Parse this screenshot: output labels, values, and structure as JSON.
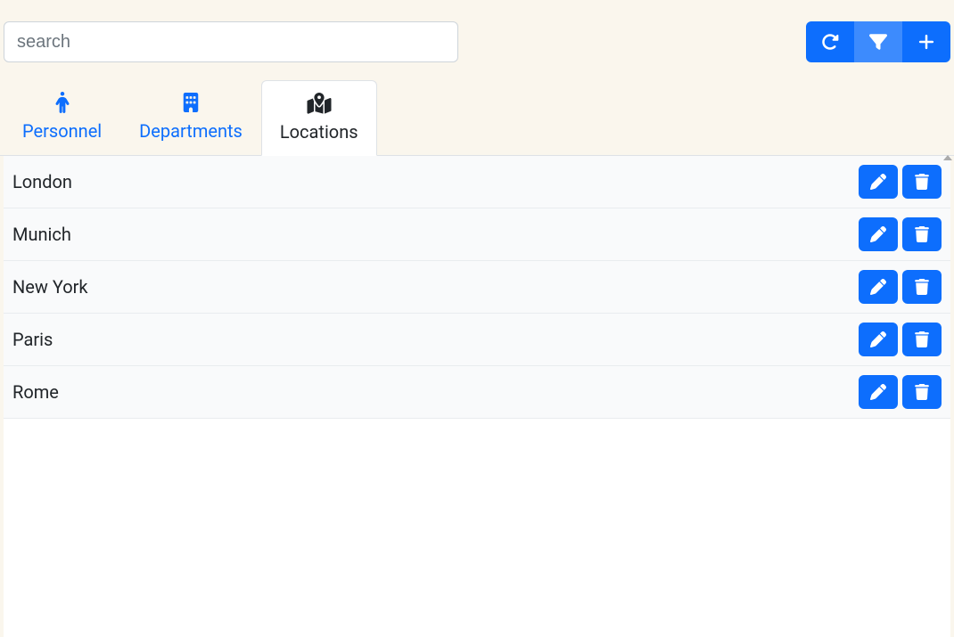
{
  "search": {
    "placeholder": "search",
    "value": ""
  },
  "toolbar": {
    "refresh": "refresh",
    "filter": "filter",
    "add": "add"
  },
  "tabs": [
    {
      "id": "personnel",
      "label": "Personnel",
      "icon": "person",
      "active": false
    },
    {
      "id": "departments",
      "label": "Departments",
      "icon": "building",
      "active": false
    },
    {
      "id": "locations",
      "label": "Locations",
      "icon": "map",
      "active": true
    }
  ],
  "locations": [
    {
      "name": "London"
    },
    {
      "name": "Munich"
    },
    {
      "name": "New York"
    },
    {
      "name": "Paris"
    },
    {
      "name": "Rome"
    }
  ],
  "row_actions": {
    "edit": "edit",
    "delete": "delete"
  }
}
